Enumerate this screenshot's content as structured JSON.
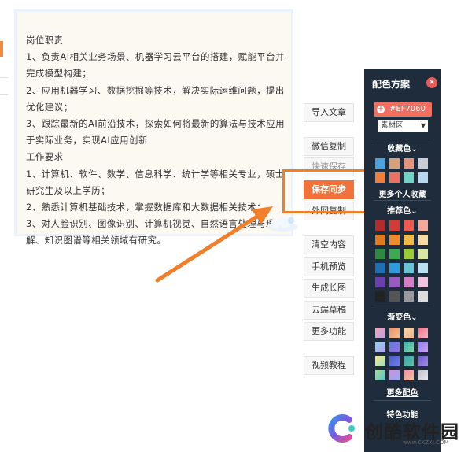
{
  "article": {
    "lines": [
      "岗位职责",
      "1、负责AI相关业务场景、机器学习云平台的搭建，赋能平台并完成模型构建；",
      "2、应用机器学习、数据挖掘等技术，解决实际运维问题，提出优化建议；",
      "3、跟踪最新的AI前沿技术，探索如何将最新的算法与技术应用于实际业务，实现AI应用创新",
      "工作要求",
      "1、计算机、软件、数学、信息科学、统计学等相关专业，硕士研究生及以上学历；",
      "2、熟悉计算机基础技术，掌握数据库和大数据相关技术；",
      "3、对人脸识别、图像识别、计算机视觉、自然语言处理与理解、知识图谱等相关领域有研究。"
    ]
  },
  "tools": {
    "import": "导入文章",
    "wechat_copy": "微信复制",
    "quick_save": "快速保存",
    "save_sync": "保存同步",
    "external_copy": "外网复制",
    "clear": "清空内容",
    "mobile_preview": "手机预览",
    "long_image": "生成长图",
    "cloud_draft": "云端草稿",
    "more": "更多功能",
    "video": "视频教程"
  },
  "palette": {
    "title": "配色方案",
    "close": "×",
    "plus": "+",
    "current_hex": "#EF7060",
    "select_value": "素材区",
    "favorites_head": "收藏色",
    "favorites_more": "更多个人收藏",
    "recommended_head": "推荐色",
    "gradient_head": "渐变色",
    "more_colors": "更多配色",
    "special_head": "特色功能",
    "chevron": "⌄",
    "favorites": [
      "#4aa3df",
      "#d7a27a",
      "#e7937b",
      "#c9ccd2",
      "#f07f3a",
      "#ef7060",
      "#6fd3c5",
      "#b7d8ef",
      "#d9b0a8",
      "#f6c4b2"
    ],
    "recommended": [
      "#b32c2c",
      "#d43b36",
      "#f05a50",
      "#f4a99a",
      "#e07a1f",
      "#f08a2d",
      "#f4b942",
      "#f8dba3",
      "#2d8a3e",
      "#3cab50",
      "#9acd32",
      "#d8e7a2",
      "#1e6fb3",
      "#2d9be0",
      "#66c6d8",
      "#b7e1f0",
      "#6b3fb0",
      "#9b59c6",
      "#d57ec7",
      "#f0c4e1",
      "#222222",
      "#555555",
      "#9a9a9a",
      "#dcdcdc"
    ],
    "gradients": [
      [
        "#f5a3b5",
        "#b8a3e6"
      ],
      [
        "#ef8f6a",
        "#f3c08a"
      ],
      [
        "#f7d8a8",
        "#f0b38f"
      ],
      [
        "#ef6f86",
        "#f5b6c2"
      ],
      [
        "#8ed0f0",
        "#b4a0f0"
      ],
      [
        "#5b7fe0",
        "#9b6de0"
      ],
      [
        "#36b3b0",
        "#7fd6a0"
      ],
      [
        "#8a7ff0",
        "#d0a0f0"
      ],
      [
        "#f5e48a",
        "#9fe0c0"
      ],
      [
        "#4b5bd0",
        "#7080e8"
      ],
      [
        "#3fa0b0",
        "#57c8a0"
      ],
      [
        "#6a5acd",
        "#a78be8"
      ],
      [
        "#a0e090",
        "#60c0d0"
      ],
      [
        "#d98ae0",
        "#8ab0f0"
      ],
      [
        "#f08aa0",
        "#f5c1a0"
      ],
      [
        "#c0c0c8",
        "#e8e8ee"
      ]
    ]
  },
  "watermark": {
    "title": "创酷软件园",
    "url": "www.CKZXJ.COM"
  },
  "colors": {
    "accent": "#f07f2b",
    "primary_button": "#f2733a",
    "panel_bg": "#1f2c3b"
  }
}
